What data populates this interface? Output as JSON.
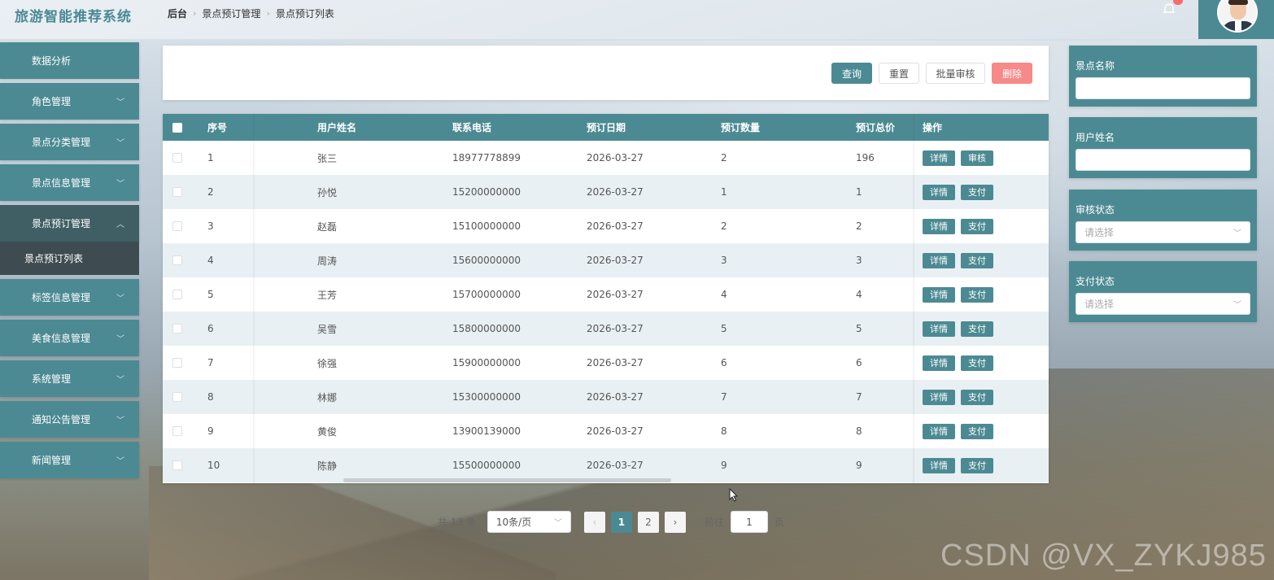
{
  "app": {
    "title": "旅游智能推荐系统"
  },
  "breadcrumb": [
    "后台",
    "景点预订管理",
    "景点预订列表"
  ],
  "sidebar": {
    "items": [
      {
        "label": "数据分析",
        "has_chevron": false
      },
      {
        "label": "角色管理",
        "has_chevron": true
      },
      {
        "label": "景点分类管理",
        "has_chevron": true
      },
      {
        "label": "景点信息管理",
        "has_chevron": true
      },
      {
        "label": "景点预订管理",
        "has_chevron": true,
        "expanded": true
      },
      {
        "label": "标签信息管理",
        "has_chevron": true
      },
      {
        "label": "美食信息管理",
        "has_chevron": true
      },
      {
        "label": "系统管理",
        "has_chevron": true
      },
      {
        "label": "通知公告管理",
        "has_chevron": true
      },
      {
        "label": "新闻管理",
        "has_chevron": true
      }
    ],
    "subitem": "景点预订列表"
  },
  "toolbar": {
    "query_label": "查询",
    "reset_label": "重置",
    "batch_review_label": "批量审核",
    "delete_label": "删除"
  },
  "table": {
    "headers": {
      "no": "序号",
      "name": "用户姓名",
      "phone": "联系电话",
      "date": "预订日期",
      "qty": "预订数量",
      "total": "预订总价",
      "op": "操作"
    },
    "detail_label": "详情",
    "rows": [
      {
        "no": "1",
        "name": "张三",
        "phone": "18977778899",
        "date": "2026-03-27",
        "qty": "2",
        "total": "196",
        "action": "审核"
      },
      {
        "no": "2",
        "name": "孙悦",
        "phone": "15200000000",
        "date": "2026-03-27",
        "qty": "1",
        "total": "1",
        "action": "支付"
      },
      {
        "no": "3",
        "name": "赵磊",
        "phone": "15100000000",
        "date": "2026-03-27",
        "qty": "2",
        "total": "2",
        "action": "支付"
      },
      {
        "no": "4",
        "name": "周涛",
        "phone": "15600000000",
        "date": "2026-03-27",
        "qty": "3",
        "total": "3",
        "action": "支付"
      },
      {
        "no": "5",
        "name": "王芳",
        "phone": "15700000000",
        "date": "2026-03-27",
        "qty": "4",
        "total": "4",
        "action": "支付"
      },
      {
        "no": "6",
        "name": "吴雪",
        "phone": "15800000000",
        "date": "2026-03-27",
        "qty": "5",
        "total": "5",
        "action": "支付"
      },
      {
        "no": "7",
        "name": "徐强",
        "phone": "15900000000",
        "date": "2026-03-27",
        "qty": "6",
        "total": "6",
        "action": "支付"
      },
      {
        "no": "8",
        "name": "林娜",
        "phone": "15300000000",
        "date": "2026-03-27",
        "qty": "7",
        "total": "7",
        "action": "支付"
      },
      {
        "no": "9",
        "name": "黄俊",
        "phone": "13900139000",
        "date": "2026-03-27",
        "qty": "8",
        "total": "8",
        "action": "支付"
      },
      {
        "no": "10",
        "name": "陈静",
        "phone": "15500000000",
        "date": "2026-03-27",
        "qty": "9",
        "total": "9",
        "action": "支付"
      }
    ]
  },
  "pagination": {
    "total_text": "共 13 条",
    "page_size": "10条/页",
    "prev": "‹",
    "pages": [
      "1",
      "2"
    ],
    "current": "1",
    "next": "›",
    "goto_prefix": "前往",
    "goto_value": "1",
    "goto_suffix": "页"
  },
  "filters": {
    "spot_name_label": "景点名称",
    "user_name_label": "用户姓名",
    "review_status_label": "审核状态",
    "review_status_placeholder": "请选择",
    "pay_status_label": "支付状态",
    "pay_status_placeholder": "请选择"
  },
  "watermark": "CSDN @VX_ZYKJ985",
  "colors": {
    "accent": "#4c8a93",
    "danger": "#f78989",
    "sidebar_open": "#3f5f64"
  }
}
